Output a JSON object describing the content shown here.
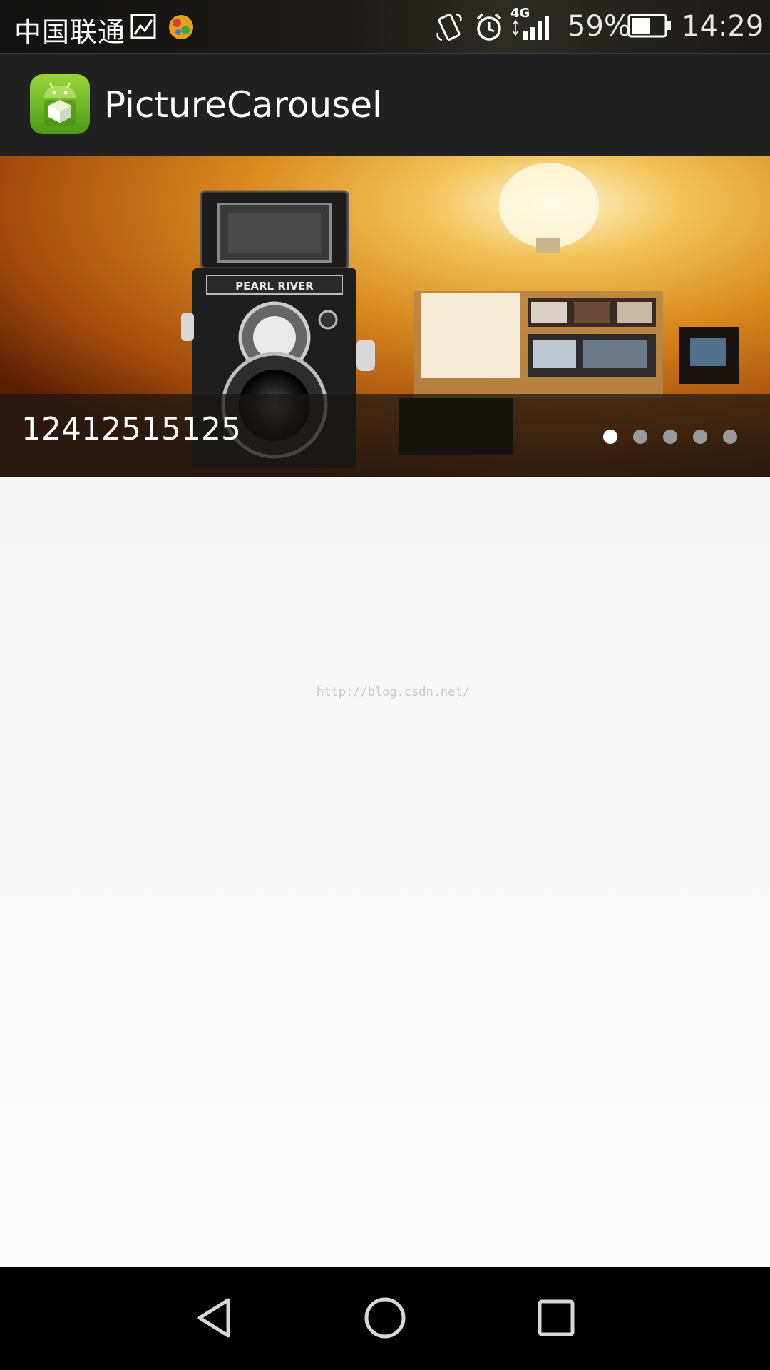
{
  "status_bar": {
    "carrier": "中国联通",
    "network_type": "4G",
    "battery_percent": "59%",
    "battery_level": 0.59,
    "time": "14:29",
    "icons": [
      "image-notification-icon",
      "app-notification-icon",
      "rotation-icon",
      "alarm-icon",
      "signal-icon",
      "battery-icon"
    ]
  },
  "app_bar": {
    "title": "PictureCarousel",
    "logo_icon": "android-app-icon"
  },
  "carousel": {
    "caption": "12412515125",
    "page_count": 5,
    "active_index": 0,
    "camera_text": "PEARL RIVER"
  },
  "watermark": "http://blog.csdn.net/",
  "nav_bar": {
    "icons": [
      "back-icon",
      "home-icon",
      "recents-icon"
    ]
  },
  "colors": {
    "status_bar": "#1a1816",
    "app_bar": "#212121",
    "nav_bar": "#000000",
    "content_bg": "#f4f4f4",
    "dot_active": "#ffffff",
    "dot_inactive": "#9a9a9a"
  }
}
